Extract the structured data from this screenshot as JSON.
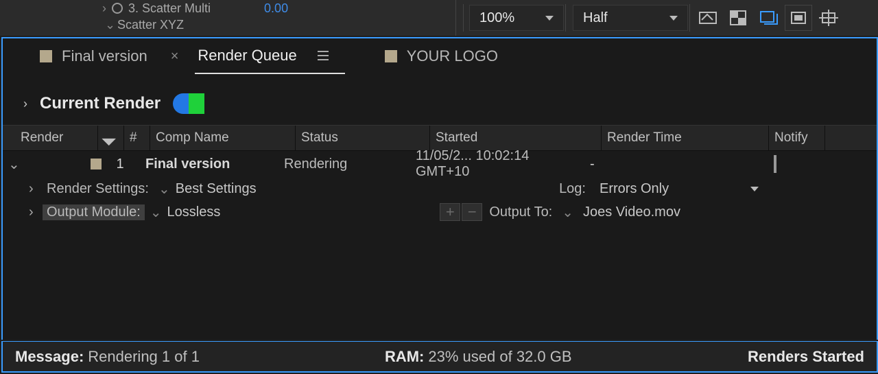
{
  "fx": {
    "scatter_multi_label": "3. Scatter Multi",
    "scatter_multi_value": "0.00",
    "scatter_xyz_label": "Scatter XYZ"
  },
  "viewer": {
    "zoom": "100%",
    "resolution": "Half"
  },
  "tabs": {
    "final_version": "Final version",
    "render_queue": "Render Queue",
    "your_logo": "YOUR LOGO"
  },
  "current_render_label": "Current Render",
  "columns": {
    "render": "Render",
    "num": "#",
    "comp": "Comp Name",
    "status": "Status",
    "started": "Started",
    "render_time": "Render Time",
    "notify": "Notify"
  },
  "rows": [
    {
      "num": "1",
      "comp": "Final version",
      "status": "Rendering",
      "started": "11/05/2... 10:02:14 GMT+10",
      "render_time": "-"
    }
  ],
  "settings": {
    "render_settings_label": "Render Settings:",
    "render_settings_value": "Best Settings",
    "log_label": "Log:",
    "log_value": "Errors Only",
    "output_module_label": "Output Module:",
    "output_module_value": "Lossless",
    "output_to_label": "Output To:",
    "output_file": "Joes Video.mov"
  },
  "footer": {
    "message_label": "Message:",
    "message_value": "Rendering 1 of 1",
    "ram_label": "RAM:",
    "ram_value": "23% used of 32.0 GB",
    "renders_label": "Renders Started"
  }
}
